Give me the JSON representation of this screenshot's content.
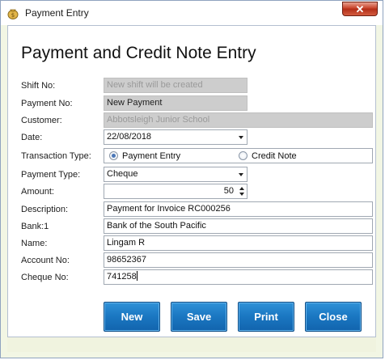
{
  "window": {
    "title": "Payment Entry",
    "close_glyph": "✕",
    "icon": "money-bag-icon"
  },
  "form": {
    "heading": "Payment and Credit Note Entry",
    "shift_no": {
      "label": "Shift No:",
      "value": "New shift will be created"
    },
    "payment_no": {
      "label": "Payment No:",
      "value": "New Payment"
    },
    "customer": {
      "label": "Customer:",
      "value": "Abbotsleigh Junior School"
    },
    "date": {
      "label": "Date:",
      "value": "22/08/2018"
    },
    "transaction_type": {
      "label": "Transaction Type:",
      "options": [
        "Payment Entry",
        "Credit Note"
      ],
      "selected": "Payment Entry"
    },
    "payment_type": {
      "label": "Payment Type:",
      "value": "Cheque"
    },
    "amount": {
      "label": "Amount:",
      "value": "50"
    },
    "description": {
      "label": "Description:",
      "value": "Payment for Invoice RC000256"
    },
    "bank": {
      "label": "Bank:1",
      "value": "Bank of the South Pacific"
    },
    "name": {
      "label": "Name:",
      "value": "Lingam R"
    },
    "account_no": {
      "label": "Account No:",
      "value": "98652367"
    },
    "cheque_no": {
      "label": "Cheque No:",
      "value": "741258"
    }
  },
  "buttons": {
    "new": "New",
    "save": "Save",
    "print": "Print",
    "close": "Close"
  },
  "colors": {
    "button_blue": "#1a76c1",
    "disabled_field": "#cdcdcd",
    "window_frame": "#f2f6e4",
    "close_red": "#c8432b"
  }
}
